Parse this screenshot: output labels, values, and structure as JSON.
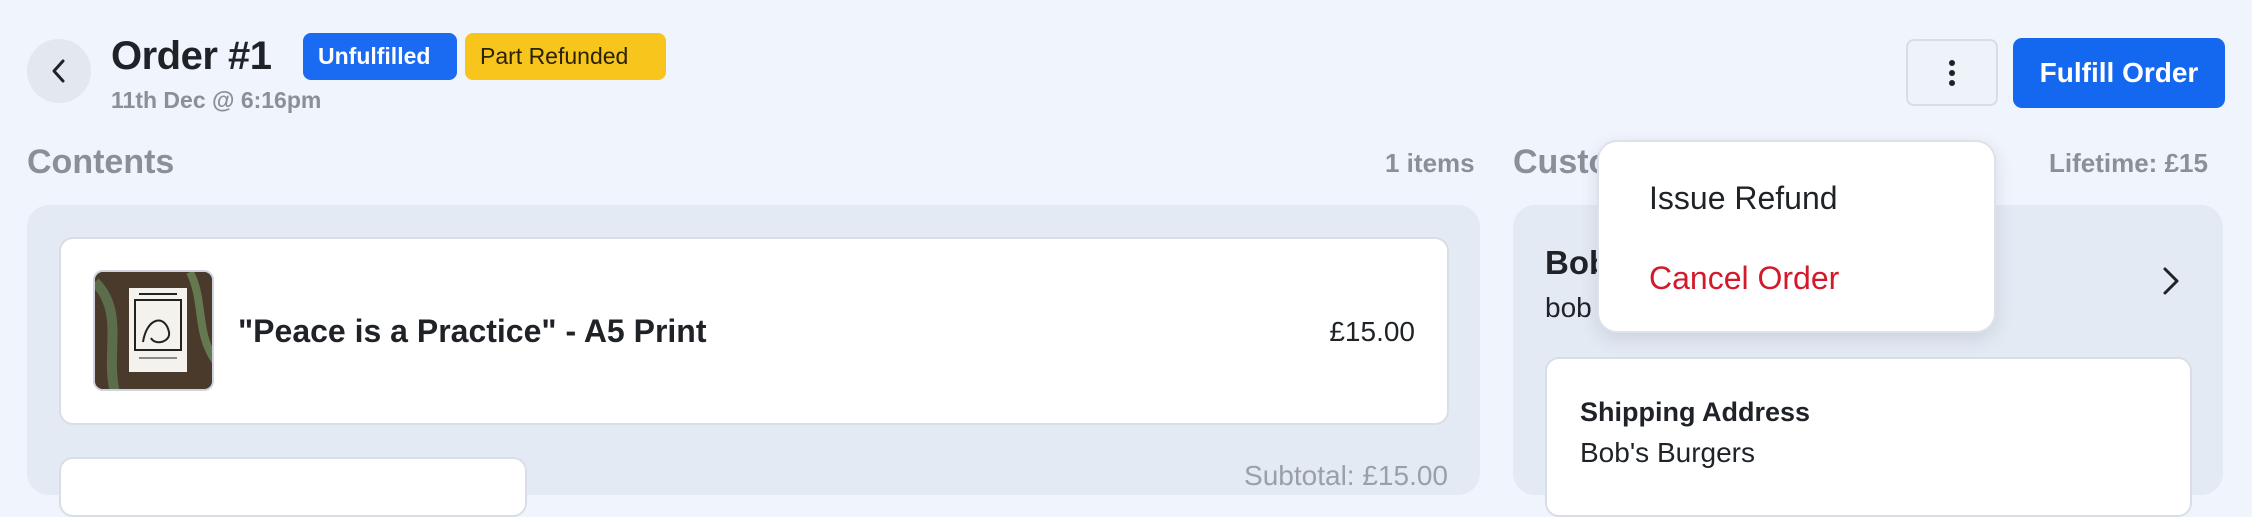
{
  "header": {
    "title": "Order #1",
    "timestamp": "11th Dec @ 6:16pm",
    "badges": {
      "fulfillment": "Unfulfilled",
      "refund": "Part Refunded"
    },
    "primary_action": "Fulfill Order"
  },
  "contents": {
    "heading": "Contents",
    "count": "1 items",
    "items": [
      {
        "title": "\"Peace is a Practice\" - A5 Print",
        "price": "£15.00"
      }
    ],
    "subtotal": "Subtotal: £15.00"
  },
  "customer": {
    "heading": "Customer",
    "lifetime": "Lifetime: £15",
    "name": "Bob",
    "email": "bob",
    "shipping": {
      "heading": "Shipping Address",
      "line1": "Bob's Burgers"
    }
  },
  "menu": {
    "items": [
      {
        "label": "Issue Refund"
      },
      {
        "label": "Cancel Order"
      }
    ]
  },
  "colors": {
    "background": "#f0f4fc",
    "primary": "#1468ef",
    "badge_unfulfilled": "#1a6af2",
    "badge_refunded": "#f8c51c",
    "danger": "#d31a2a"
  },
  "icons": [
    "chevron-left-icon",
    "more-vertical-icon",
    "chevron-right-icon"
  ]
}
